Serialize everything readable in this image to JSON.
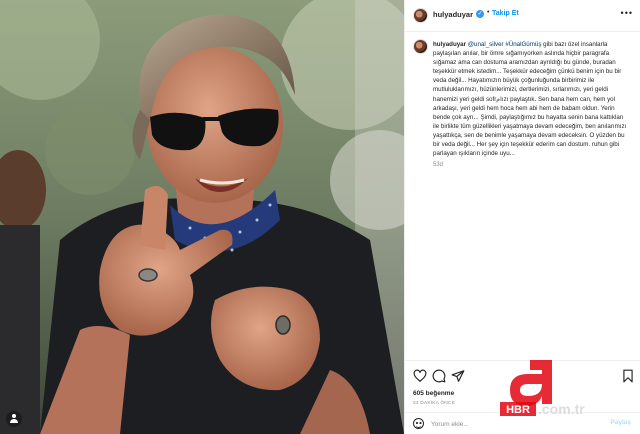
{
  "post": {
    "username": "hulyaduyar",
    "follow_label": "Takip Et",
    "separator": "•",
    "more_label": "•••",
    "verified_mark": "✓"
  },
  "caption": {
    "username": "hulyaduyar",
    "mentions": "@unal_silver #ÜnalGümüş",
    "text": " gibi bazı özel insanlarla paylaşılan anılar, bir ömre sığamıyorken aslında hiçbir paragrafa sığamaz ama can dostuma aramızdan ayrıldığı bu günde, buradan teşekkür etmek istedim... Teşekkür edeceğim çünkü benim için bu bir veda değil... Hayatımızın büyük çoğunluğunda birbirimiz ile mutluluklarımızı, hüzünlerimizi, dertlerimizi, sırlarımızı, yeri geldi hanemizi yeri geldi sofrامızı paylaştık. Sen bana hem can, hem yol arkadaşı, yeri geldi hem hoca hem abi hem de babam oldun. Yerin bende çok ayrı... Şimdi, paylaştığımız bu hayatta senin bana kattıkları ile birlikte tüm güzellikleri yaşatmaya devam edeceğim, ben anılarımızı yaşattıkça, sen de benimle yaşamaya devam edeceksin. O yüzden bu bir veda değil... Her şey için teşekkür ederim can dostum. ruhun gibi parlayan ışıkların içinde uyu...",
    "ago": "53d"
  },
  "stats": {
    "likes": "605 beğenme",
    "posted": "53 DAKİKA ÖNCE"
  },
  "comment_box": {
    "placeholder": "Yorum ekle...",
    "post_label": "Paylaş"
  },
  "watermark": {
    "letter": "a",
    "brand": "HBR",
    "domain": ".com.tr"
  },
  "icons": {
    "like": "heart-icon",
    "comment": "comment-bubble-icon",
    "share": "paper-plane-icon",
    "save": "bookmark-icon",
    "tag": "user-tag-icon",
    "emoji": "smiley-icon"
  },
  "colors": {
    "accent": "#0095f6",
    "verified": "#3897f0",
    "watermark_red": "#e30613"
  }
}
